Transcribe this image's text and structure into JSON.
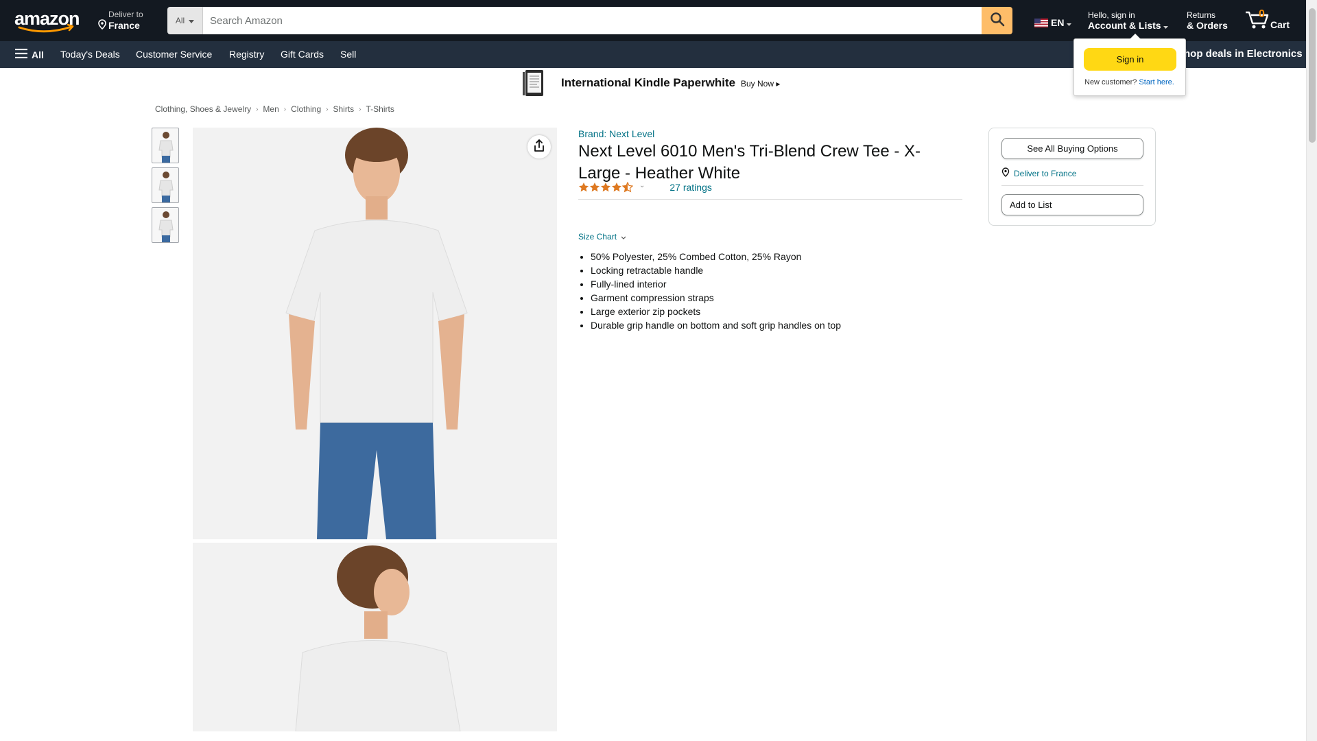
{
  "header": {
    "logo_text": "amazon",
    "deliver": {
      "line1": "Deliver to",
      "line2": "France"
    },
    "search": {
      "category": "All",
      "placeholder": "Search Amazon"
    },
    "language": "EN",
    "account": {
      "line1": "Hello, sign in",
      "line2": "Account & Lists"
    },
    "returns": {
      "line1": "Returns",
      "line2": "& Orders"
    },
    "cart": {
      "count": "0",
      "label": "Cart"
    }
  },
  "subnav": {
    "all_label": "All",
    "links": [
      "Today's Deals",
      "Customer Service",
      "Registry",
      "Gift Cards",
      "Sell"
    ],
    "promo": "Shop deals in Electronics"
  },
  "banner": {
    "title": "International Kindle Paperwhite",
    "cta": "Buy Now"
  },
  "breadcrumb": [
    "Clothing, Shoes & Jewelry",
    "Men",
    "Clothing",
    "Shirts",
    "T-Shirts"
  ],
  "product": {
    "brand": "Brand: Next Level",
    "title": "Next Level 6010 Men's Tri-Blend Crew Tee - X-Large - Heather White",
    "rating_stars": 4.5,
    "ratings_count": "27 ratings",
    "size_chart": "Size Chart",
    "bullets": [
      "50% Polyester, 25% Combed Cotton, 25% Rayon",
      "Locking retractable handle",
      "Fully-lined interior",
      "Garment compression straps",
      "Large exterior zip pockets",
      "Durable grip handle on bottom and soft grip handles on top"
    ]
  },
  "buybox": {
    "see_all": "See All Buying Options",
    "deliver": "Deliver to France",
    "add_to_list": "Add to List"
  },
  "signin_flyout": {
    "button": "Sign in",
    "new_customer": "New customer?",
    "start_here": "Start here."
  },
  "colors": {
    "nav_dark": "#131921",
    "nav_sub": "#232f3e",
    "search_button": "#febd69",
    "signin_button": "#ffd814",
    "link": "#007185",
    "star": "#de7921"
  }
}
